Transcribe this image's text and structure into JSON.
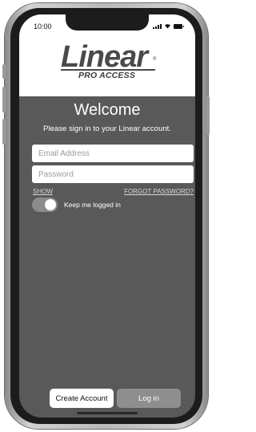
{
  "status_bar": {
    "time": "10:00"
  },
  "brand": {
    "name": "Linear",
    "sub": "PRO ACCESS",
    "mark": "®"
  },
  "welcome": {
    "title": "Welcome",
    "subtitle": "Please sign in to your Linear account."
  },
  "form": {
    "email_placeholder": "Email Address",
    "email_value": "",
    "password_placeholder": "Password",
    "password_value": "",
    "show_label": "SHOW",
    "forgot_label": "FORGOT PASSWORD?",
    "keep_logged_in_label": "Keep me logged in",
    "keep_logged_in_on": true
  },
  "actions": {
    "create_account_label": "Create Account",
    "login_label": "Log in"
  },
  "colors": {
    "screen_bg": "#595959",
    "header_bg": "#ffffff",
    "login_button_bg": "#8e8e8e",
    "toggle_bg": "#8b8b8b"
  },
  "icons": [
    "signal-icon",
    "wifi-icon",
    "battery-icon"
  ]
}
